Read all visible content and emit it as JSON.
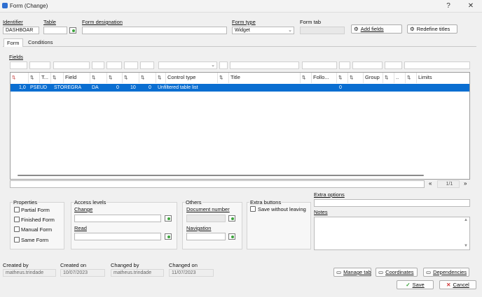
{
  "window": {
    "title": "Form (Change)",
    "help_glyph": "?",
    "close_glyph": "✕"
  },
  "header": {
    "identifier_label": "Identifier",
    "identifier_value": "DASHBOAR",
    "table_label": "Table",
    "table_value": "",
    "designation_label": "Form designation",
    "designation_value": "",
    "form_type_label": "Form type",
    "form_type_value": "Widget",
    "form_tab_label": "Form tab",
    "form_tab_value": "",
    "add_fields_label": "Add fields",
    "redefine_titles_label": "Redefine titles"
  },
  "tabs": [
    {
      "label": "Form",
      "active": true
    },
    {
      "label": "Conditions",
      "active": false
    }
  ],
  "fields": {
    "label": "Fields",
    "columns": [
      "",
      "",
      "T...",
      "Field",
      "",
      "",
      "",
      "",
      "Control type",
      "",
      "Title",
      "",
      "Follo...",
      "",
      "Group",
      "",
      "..",
      "",
      "Limits"
    ],
    "rows": [
      {
        "seq": "1,0",
        "type": "PSEUD",
        "field": "STOREGRA",
        "da": "DA",
        "c1": "0",
        "c2": "10",
        "c3": "0",
        "control": "Unfiltered table list",
        "follow": "0",
        "selected": true
      }
    ],
    "pager_first": "«",
    "pager_text": "1/1",
    "pager_last": "»"
  },
  "properties": {
    "title": "Properties",
    "items": [
      {
        "label": "Partial Form",
        "checked": false
      },
      {
        "label": "Finished Form",
        "checked": false
      },
      {
        "label": "Manual Form",
        "checked": false
      },
      {
        "label": "Same Form",
        "checked": false
      }
    ]
  },
  "access_levels": {
    "title": "Access levels",
    "change_label": "Change",
    "change_value": "",
    "read_label": "Read",
    "read_value": ""
  },
  "others": {
    "title": "Others",
    "document_number_label": "Document number",
    "document_number_value": "",
    "navigation_label": "Navigation",
    "navigation_value": ""
  },
  "extra_buttons": {
    "title": "Extra buttons",
    "save_without_leaving_label": "Save without leaving"
  },
  "extra_options": {
    "label": "Extra options",
    "value": "",
    "notes_label": "Notes",
    "notes_value": ""
  },
  "audit": {
    "created_by_label": "Created by",
    "created_by_value": "matheus.trindade",
    "created_on_label": "Created on",
    "created_on_value": "10/07/2023",
    "changed_by_label": "Changed by",
    "changed_by_value": "matheus.trindade",
    "changed_on_label": "Changed on",
    "changed_on_value": "11/07/2023"
  },
  "footer": {
    "manage_tab_label": "Manage tab",
    "coordinates_label": "Coordinates",
    "dependencies_label": "Dependencies",
    "save_label": "Save",
    "cancel_label": "Cancel"
  },
  "colors": {
    "selection": "#0a6ed1",
    "save_check": "#2e9b2e",
    "cancel_x": "#d03030"
  }
}
